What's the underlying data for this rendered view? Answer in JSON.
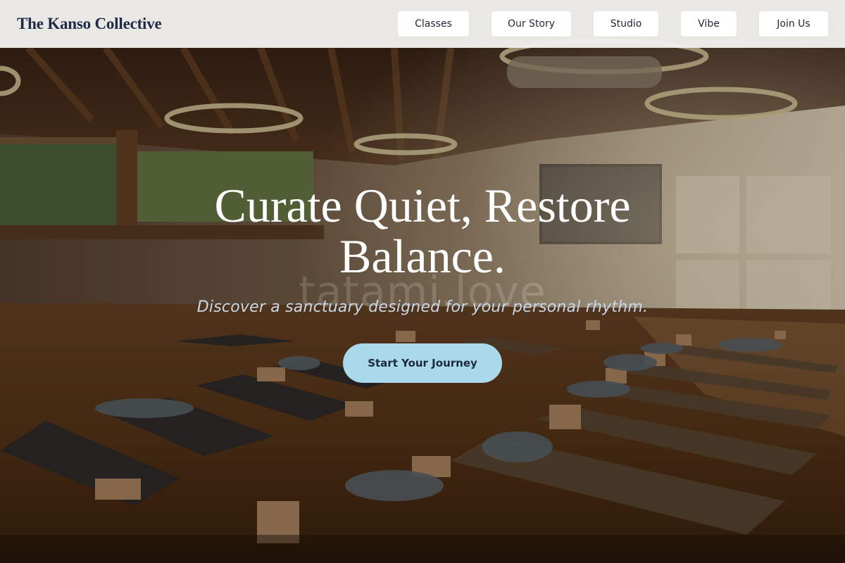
{
  "header": {
    "brand": "The Kanso Collective",
    "nav": [
      {
        "label": "Classes"
      },
      {
        "label": "Our Story"
      },
      {
        "label": "Studio"
      },
      {
        "label": "Vibe"
      },
      {
        "label": "Join Us"
      }
    ]
  },
  "hero": {
    "headline_line1": "Curate Quiet, Restore",
    "headline_line2": "Balance.",
    "watermark": "tatami.love",
    "subheadline": "Discover a sanctuary designed for your personal rhythm.",
    "cta_label": "Start Your Journey"
  },
  "colors": {
    "brand_text": "#1f2a44",
    "header_bg": "#f0eeec",
    "cta_bg": "#a9d9ea",
    "subheadline": "#c7d8e8"
  }
}
